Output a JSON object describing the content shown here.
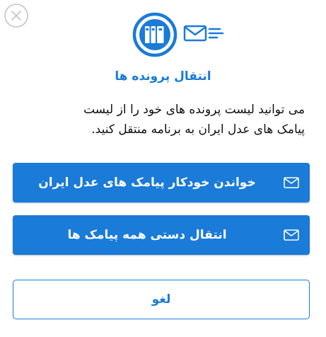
{
  "dialog": {
    "title": "انتقال پرونده ها",
    "description_lines": [
      "می توانید لیست پرونده های خود را از لیست",
      "پیامک های عدل ایران به برنامه منتقل کنید."
    ],
    "icons": {
      "close": "close-icon",
      "hero": "binders-icon",
      "hero_secondary": "mail-lines-icon",
      "button": "mail-icon"
    }
  },
  "buttons": {
    "auto_read_label": "خواندن خودکار پیامک های عدل ایران",
    "manual_transfer_label": "انتقال دستی همه پیامک ها",
    "cancel_label": "لغو"
  },
  "colors": {
    "accent": "#1a7bd8",
    "text": "#111111",
    "close_gray": "#c4c4c4"
  }
}
